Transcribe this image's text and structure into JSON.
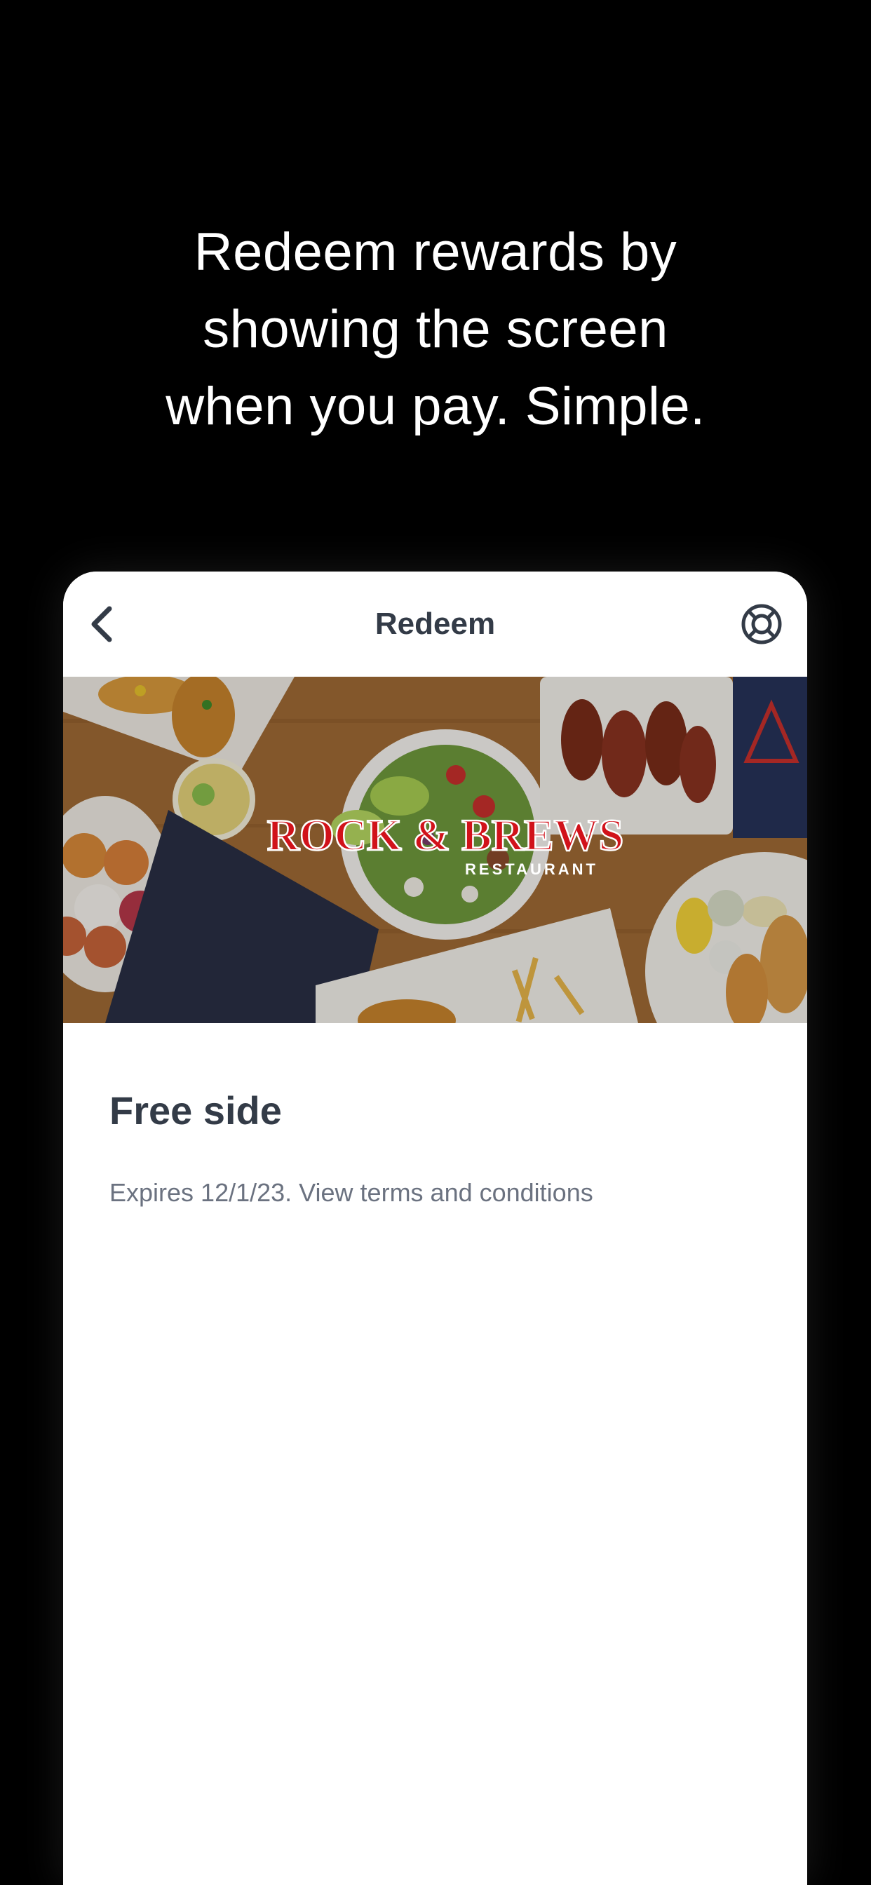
{
  "promo": {
    "headline_lines": [
      "Redeem rewards by",
      "showing the screen",
      "when you pay. Simple."
    ]
  },
  "nav": {
    "title": "Redeem",
    "back_icon": "chevron-left-icon",
    "help_icon": "lifebuoy-icon"
  },
  "hero": {
    "brand_logo_text": "ROCK & BREWS",
    "brand_logo_subtext": "RESTAURANT"
  },
  "reward": {
    "title": "Free side",
    "expires_text": "Expires 12/1/23.",
    "terms_link": "View terms and conditions"
  },
  "colors": {
    "background": "#000000",
    "card": "#ffffff",
    "title_text": "#333b47",
    "meta_text": "#6b7280",
    "brand_red": "#d1121a"
  }
}
